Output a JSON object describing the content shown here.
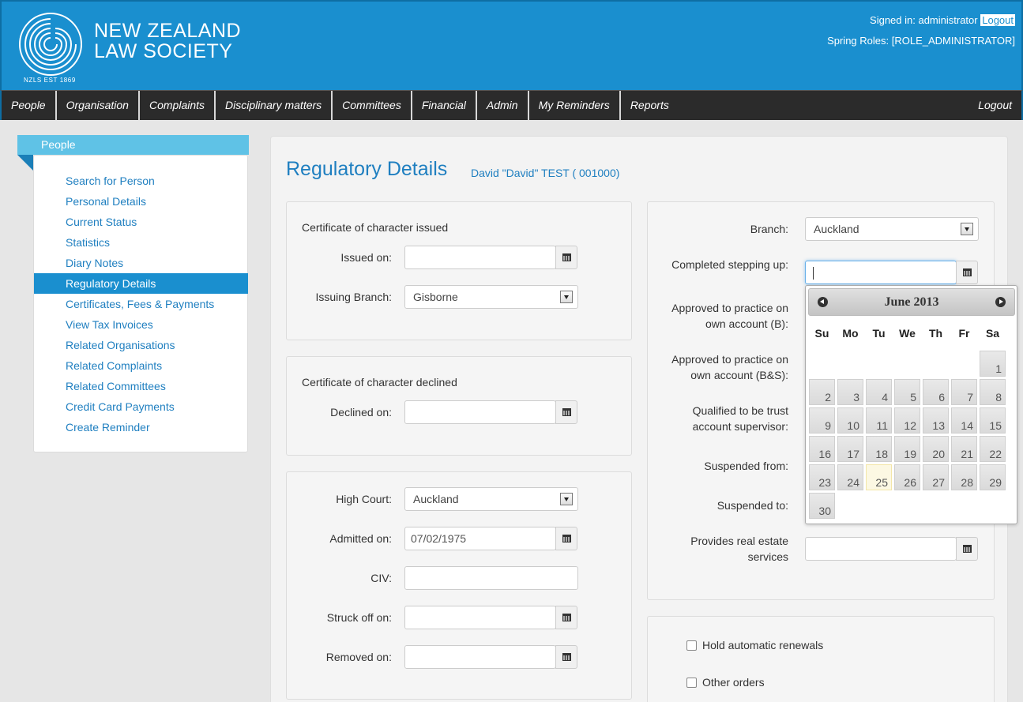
{
  "header": {
    "logo_line1": "NEW ZEALAND",
    "logo_line2": "LAW SOCIETY",
    "logo_est": "NZLS EST 1869",
    "signed_in_label": "Signed in: administrator",
    "logout_link": "Logout",
    "roles": "Spring Roles: [ROLE_ADMINISTRATOR]"
  },
  "nav": {
    "items": [
      "People",
      "Organisation",
      "Complaints",
      "Disciplinary matters",
      "Committees",
      "Financial",
      "Admin",
      "My Reminders",
      "Reports"
    ],
    "logout": "Logout"
  },
  "sidebar": {
    "title": "People",
    "items": [
      "Search for Person",
      "Personal Details",
      "Current Status",
      "Statistics",
      "Diary Notes",
      "Regulatory Details",
      "Certificates, Fees & Payments",
      "View Tax Invoices",
      "Related Organisations",
      "Related Complaints",
      "Related Committees",
      "Credit Card Payments",
      "Create Reminder"
    ],
    "active_index": 5
  },
  "page": {
    "title": "Regulatory Details",
    "person": "David \"David\" TEST ( 001000)"
  },
  "certificate_issued": {
    "title": "Certificate of character issued",
    "issued_on_label": "Issued on:",
    "issued_on_value": "",
    "issuing_branch_label": "Issuing Branch:",
    "issuing_branch_value": "Gisborne"
  },
  "certificate_declined": {
    "title": "Certificate of character declined",
    "declined_on_label": "Declined on:",
    "declined_on_value": ""
  },
  "court": {
    "high_court_label": "High Court:",
    "high_court_value": "Auckland",
    "admitted_on_label": "Admitted on:",
    "admitted_on_value": "07/02/1975",
    "civ_label": "CIV:",
    "civ_value": "",
    "struck_off_label": "Struck off on:",
    "struck_off_value": "",
    "removed_on_label": "Removed on:",
    "removed_on_value": ""
  },
  "right_panel": {
    "branch_label": "Branch:",
    "branch_value": "Auckland",
    "stepping_up_label": "Completed stepping up:",
    "stepping_up_value": "",
    "approved_b_label_1": "Approved to practice on",
    "approved_b_label_2": "own account (B):",
    "approved_bs_label_1": "Approved to practice on",
    "approved_bs_label_2": "own account (B&S):",
    "qualified_label_1": "Qualified to be trust",
    "qualified_label_2": "account supervisor:",
    "suspended_from_label": "Suspended from:",
    "suspended_to_label": "Suspended to:",
    "real_estate_label_1": "Provides real estate",
    "real_estate_label_2": "services",
    "real_estate_value": ""
  },
  "options": {
    "hold_renewals_label": "Hold automatic renewals",
    "hold_renewals_checked": false,
    "other_orders_label": "Other orders",
    "other_orders_checked": false
  },
  "datepicker": {
    "title": "June 2013",
    "weekdays": [
      "Su",
      "Mo",
      "Tu",
      "We",
      "Th",
      "Fr",
      "Sa"
    ],
    "first_weekday_index": 6,
    "days_in_month": 30,
    "today": 25
  }
}
